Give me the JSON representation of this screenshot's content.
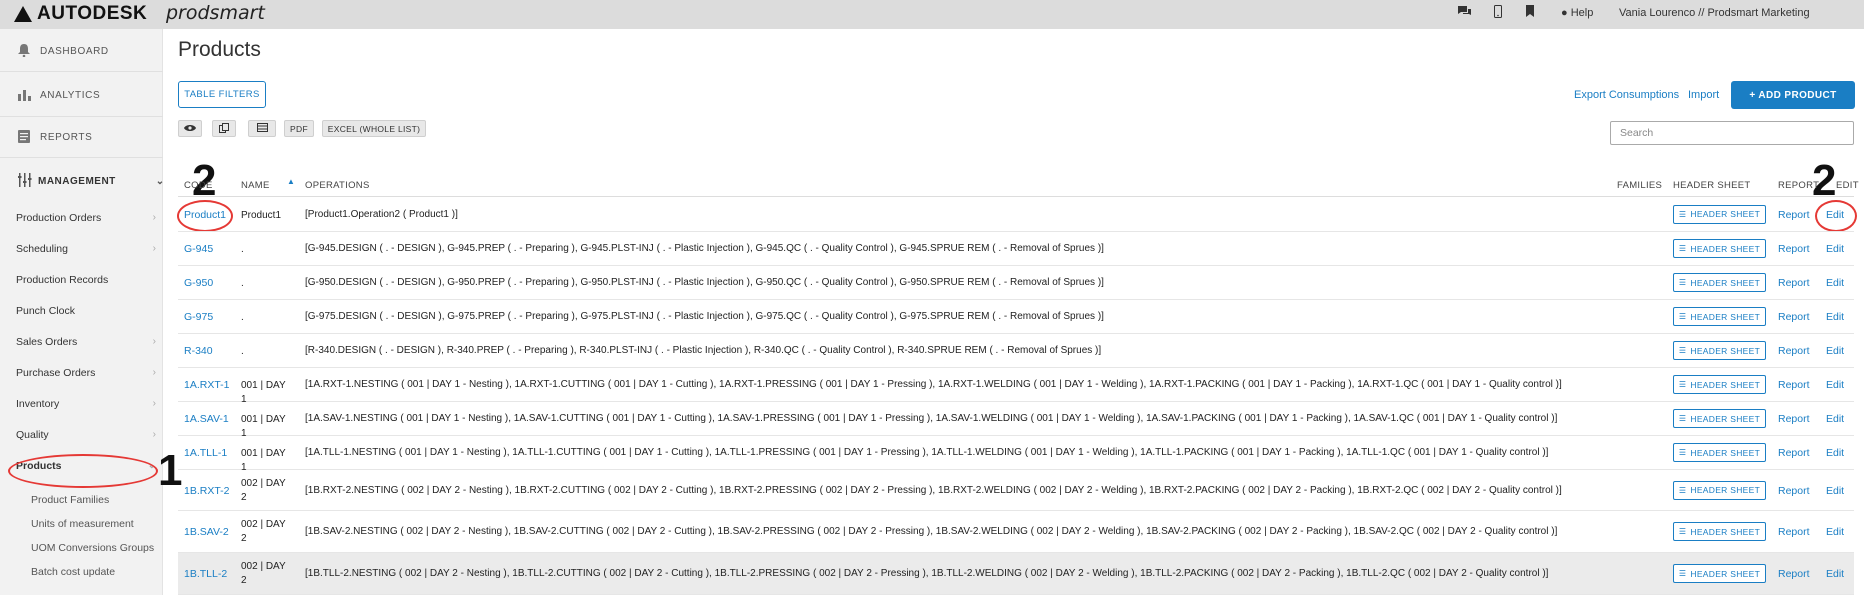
{
  "topbar": {
    "brand": "AUTODESK",
    "product": "prodsmart",
    "help_label": "Help",
    "user_label": "Vania Lourenco // Prodsmart Marketing"
  },
  "sidebar": {
    "dashboard": "DASHBOARD",
    "analytics": "ANALYTICS",
    "reports": "REPORTS",
    "management": "MANAGEMENT",
    "items": [
      {
        "label": "Production Orders"
      },
      {
        "label": "Scheduling"
      },
      {
        "label": "Production Records"
      },
      {
        "label": "Punch Clock"
      },
      {
        "label": "Sales Orders"
      },
      {
        "label": "Purchase Orders"
      },
      {
        "label": "Inventory"
      },
      {
        "label": "Quality"
      },
      {
        "label": "Products"
      }
    ],
    "subitems": [
      "Product Families",
      "Units of measurement",
      "UOM Conversions Groups",
      "Batch cost update"
    ]
  },
  "annotations": {
    "one": "1",
    "two": "2"
  },
  "main": {
    "title": "Products",
    "table_filters": "TABLE FILTERS",
    "export_consumptions": "Export Consumptions",
    "import": "Import",
    "add_product": "+ ADD PRODUCT",
    "pdf": "PDF",
    "excel": "EXCEL (WHOLE LIST)",
    "search_placeholder": "Search"
  },
  "table": {
    "headers": {
      "code": "CODE",
      "name": "NAME",
      "operations": "OPERATIONS",
      "families": "FAMILIES",
      "header_sheet": "HEADER SHEET",
      "report": "REPORT",
      "edit": "EDIT"
    },
    "header_sheet_label": "HEADER SHEET",
    "report_label": "Report",
    "edit_label": "Edit",
    "rows": [
      {
        "code": "Product1",
        "name": "Product1",
        "operations": "[Product1.Operation2 ( Product1 )]"
      },
      {
        "code": "G-945",
        "name": ".",
        "operations": "[G-945.DESIGN ( . - DESIGN ), G-945.PREP ( . - Preparing ), G-945.PLST-INJ ( . - Plastic Injection ), G-945.QC ( . - Quality Control ), G-945.SPRUE REM ( . - Removal of Sprues )]"
      },
      {
        "code": "G-950",
        "name": ".",
        "operations": "[G-950.DESIGN ( . - DESIGN ), G-950.PREP ( . - Preparing ), G-950.PLST-INJ ( . - Plastic Injection ), G-950.QC ( . - Quality Control ), G-950.SPRUE REM ( . - Removal of Sprues )]"
      },
      {
        "code": "G-975",
        "name": ".",
        "operations": "[G-975.DESIGN ( . - DESIGN ), G-975.PREP ( . - Preparing ), G-975.PLST-INJ ( . - Plastic Injection ), G-975.QC ( . - Quality Control ), G-975.SPRUE REM ( . - Removal of Sprues )]"
      },
      {
        "code": "R-340",
        "name": ".",
        "operations": "[R-340.DESIGN ( . - DESIGN ), R-340.PREP ( . - Preparing ), R-340.PLST-INJ ( . - Plastic Injection ), R-340.QC ( . - Quality Control ), R-340.SPRUE REM ( . - Removal of Sprues )]"
      },
      {
        "code": "1A.RXT-1",
        "name": "001 | DAY 1",
        "operations": "[1A.RXT-1.NESTING ( 001 | DAY 1 - Nesting ), 1A.RXT-1.CUTTING ( 001 | DAY 1 - Cutting ), 1A.RXT-1.PRESSING ( 001 | DAY 1 - Pressing ), 1A.RXT-1.WELDING ( 001 | DAY 1 - Welding ), 1A.RXT-1.PACKING ( 001 | DAY 1 - Packing ), 1A.RXT-1.QC ( 001 | DAY 1 - Quality control )]"
      },
      {
        "code": "1A.SAV-1",
        "name": "001 | DAY 1",
        "operations": "[1A.SAV-1.NESTING ( 001 | DAY 1 - Nesting ), 1A.SAV-1.CUTTING ( 001 | DAY 1 - Cutting ), 1A.SAV-1.PRESSING ( 001 | DAY 1 - Pressing ), 1A.SAV-1.WELDING ( 001 | DAY 1 - Welding ), 1A.SAV-1.PACKING ( 001 | DAY 1 - Packing ), 1A.SAV-1.QC ( 001 | DAY 1 - Quality control )]"
      },
      {
        "code": "1A.TLL-1",
        "name": "001 | DAY 1",
        "operations": "[1A.TLL-1.NESTING ( 001 | DAY 1 - Nesting ), 1A.TLL-1.CUTTING ( 001 | DAY 1 - Cutting ), 1A.TLL-1.PRESSING ( 001 | DAY 1 - Pressing ), 1A.TLL-1.WELDING ( 001 | DAY 1 - Welding ), 1A.TLL-1.PACKING ( 001 | DAY 1 - Packing ), 1A.TLL-1.QC ( 001 | DAY 1 - Quality control )]"
      },
      {
        "code": "1B.RXT-2",
        "name": "002 | DAY 2",
        "operations": "[1B.RXT-2.NESTING ( 002 | DAY 2 - Nesting ), 1B.RXT-2.CUTTING ( 002 | DAY 2 - Cutting ), 1B.RXT-2.PRESSING ( 002 | DAY 2 - Pressing ), 1B.RXT-2.WELDING ( 002 | DAY 2 - Welding ), 1B.RXT-2.PACKING ( 002 | DAY 2 - Packing ), 1B.RXT-2.QC ( 002 | DAY 2 - Quality control )]"
      },
      {
        "code": "1B.SAV-2",
        "name": "002 | DAY 2",
        "operations": "[1B.SAV-2.NESTING ( 002 | DAY 2 - Nesting ), 1B.SAV-2.CUTTING ( 002 | DAY 2 - Cutting ), 1B.SAV-2.PRESSING ( 002 | DAY 2 - Pressing ), 1B.SAV-2.WELDING ( 002 | DAY 2 - Welding ), 1B.SAV-2.PACKING ( 002 | DAY 2 - Packing ), 1B.SAV-2.QC ( 002 | DAY 2 - Quality control )]"
      },
      {
        "code": "1B.TLL-2",
        "name": "002 | DAY 2",
        "operations": "[1B.TLL-2.NESTING ( 002 | DAY 2 - Nesting ), 1B.TLL-2.CUTTING ( 002 | DAY 2 - Cutting ), 1B.TLL-2.PRESSING ( 002 | DAY 2 - Pressing ), 1B.TLL-2.WELDING ( 002 | DAY 2 - Welding ), 1B.TLL-2.PACKING ( 002 | DAY 2 - Packing ), 1B.TLL-2.QC ( 002 | DAY 2 - Quality control )]"
      }
    ]
  },
  "colors": {
    "accent": "#1a7ec4",
    "annotation": "#e53935"
  }
}
